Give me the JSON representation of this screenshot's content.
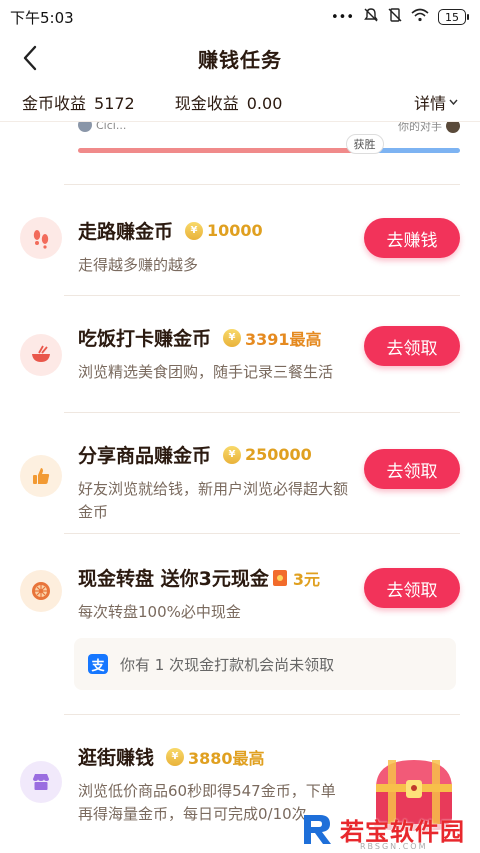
{
  "status_bar": {
    "time": "下午5:03",
    "battery": "15"
  },
  "nav": {
    "title": "赚钱任务"
  },
  "earnings": {
    "coin_label": "金币收益",
    "coin_value": "5172",
    "cash_label": "现金收益",
    "cash_value": "0.00",
    "detail_label": "详情"
  },
  "race": {
    "left_name": "Cici...",
    "right_name": "你的对手",
    "win_label": "获胜",
    "progress": 0.75
  },
  "tasks": [
    {
      "title": "走路赚金币",
      "reward": "10000",
      "desc": "走得越多赚的越多",
      "button": "去赚钱",
      "icon": "footprints-icon",
      "icon_bg": "#fde9e6",
      "icon_color": "#f26b5b"
    },
    {
      "title": "吃饭打卡赚金币",
      "reward": "3391最高",
      "desc": "浏览精选美食团购，随手记录三餐生活",
      "button": "去领取",
      "icon": "bowl-icon",
      "icon_bg": "#fde9e6",
      "icon_color": "#e9574b"
    },
    {
      "title": "分享商品赚金币",
      "reward": "250000",
      "desc": "好友浏览就给钱，新用户浏览必得超大额金币",
      "button": "去领取",
      "icon": "thumbs-up-icon",
      "icon_bg": "#fdf0e0",
      "icon_color": "#f29a33"
    },
    {
      "title": "现金转盘 送你3元现金",
      "reward": "3元",
      "desc": "每次转盘100%必中现金",
      "button": "去领取",
      "icon": "wheel-icon",
      "icon_bg": "#fdeedd",
      "icon_color": "#e8743a"
    },
    {
      "title": "逛街赚钱",
      "reward": "3880最高",
      "desc": "浏览低价商品60秒即得547金币，下单再得海量金币，每日可完成0/10次",
      "button": "",
      "icon": "shop-icon",
      "icon_bg": "#f1e9fb",
      "icon_color": "#9a6de0"
    }
  ],
  "cash_notice": {
    "text": "你有 1 次现金打款机会尚未领取"
  },
  "watermark": {
    "text": "若宝软件园",
    "sub": "RBSGN.COM"
  },
  "colors": {
    "accent": "#f2335a",
    "reward": "#e0a020"
  }
}
